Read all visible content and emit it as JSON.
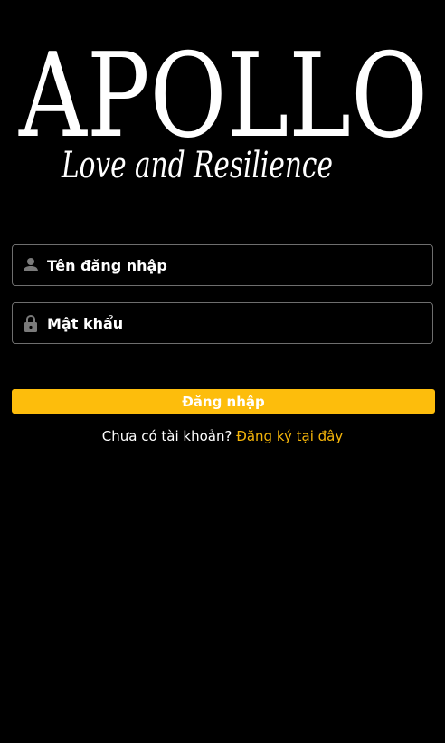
{
  "brand": {
    "logo_title": "APOLLO",
    "logo_tagline": "Love and Resilience"
  },
  "login_form": {
    "username_placeholder": "Tên đăng nhập",
    "password_placeholder": "Mật khẩu",
    "username_icon": "person-icon",
    "password_icon": "lock-icon",
    "submit_label": "Đăng nhập"
  },
  "register": {
    "prompt": "Chưa có tài khoản?",
    "link_label": "Đăng ký tại đây"
  },
  "colors": {
    "background": "#000000",
    "accent": "#fdbd0c",
    "link": "#f5b50a",
    "field_border": "#6e6e6e",
    "icon": "#7a7a7a"
  }
}
